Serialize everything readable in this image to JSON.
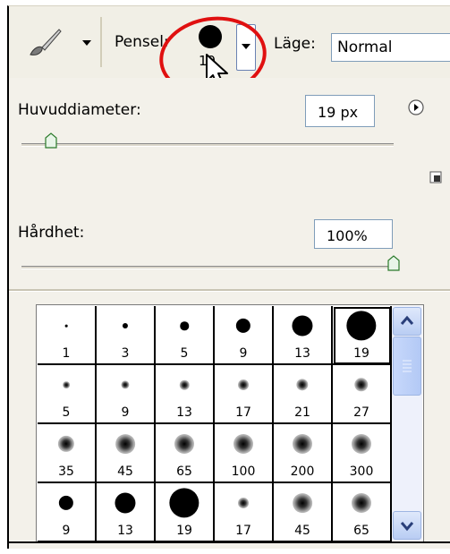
{
  "options_bar": {
    "tool_icon": "brush-icon",
    "pensel_label": "Pensel:",
    "brush_size_preview": "19",
    "lage_label": "Läge:",
    "mode_value": "Normal"
  },
  "panel": {
    "diameter_label": "Huvuddiameter:",
    "diameter_value": "19 px",
    "diameter_fraction": 0.08,
    "hardness_label": "Hårdhet:",
    "hardness_value": "100%",
    "hardness_fraction": 1.0
  },
  "presets": [
    {
      "size": "1",
      "style": "hard"
    },
    {
      "size": "3",
      "style": "hard"
    },
    {
      "size": "5",
      "style": "hard"
    },
    {
      "size": "9",
      "style": "hard"
    },
    {
      "size": "13",
      "style": "hard"
    },
    {
      "size": "19",
      "style": "hard",
      "selected": true
    },
    {
      "size": "5",
      "style": "soft"
    },
    {
      "size": "9",
      "style": "soft"
    },
    {
      "size": "13",
      "style": "soft"
    },
    {
      "size": "17",
      "style": "soft"
    },
    {
      "size": "21",
      "style": "soft"
    },
    {
      "size": "27",
      "style": "soft"
    },
    {
      "size": "35",
      "style": "soft"
    },
    {
      "size": "45",
      "style": "soft"
    },
    {
      "size": "65",
      "style": "soft"
    },
    {
      "size": "100",
      "style": "soft"
    },
    {
      "size": "200",
      "style": "soft"
    },
    {
      "size": "300",
      "style": "soft"
    },
    {
      "size": "9",
      "style": "hard"
    },
    {
      "size": "13",
      "style": "hard"
    },
    {
      "size": "19",
      "style": "hard"
    },
    {
      "size": "17",
      "style": "soft"
    },
    {
      "size": "45",
      "style": "soft"
    },
    {
      "size": "65",
      "style": "soft"
    }
  ],
  "colors": {
    "highlight_circle": "#e01010",
    "panel_bg": "#f3f1ea"
  }
}
